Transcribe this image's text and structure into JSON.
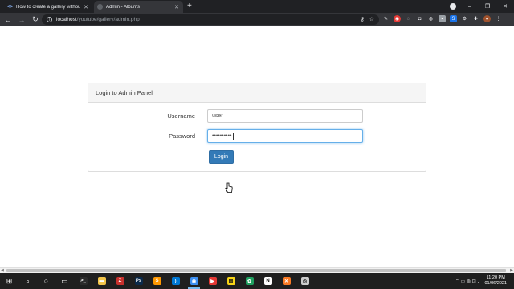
{
  "browser": {
    "tabs": [
      {
        "title": "How to create a gallery without a...",
        "icon": "code-icon",
        "active": false
      },
      {
        "title": "Admin - Albums",
        "icon": "globe-icon",
        "active": true
      }
    ],
    "new_tab_glyph": "+",
    "window_controls": {
      "minimize": "–",
      "maximize": "❐",
      "close": "✕"
    },
    "toolbar": {
      "back": "←",
      "forward": "→",
      "reload": "↻",
      "url_host": "localhost",
      "url_path": "/youtube/gallery/admin.php"
    }
  },
  "panel": {
    "heading": "Login to Admin Panel",
    "username_label": "Username",
    "username_value": "user",
    "password_label": "Password",
    "password_value": "••••••••••",
    "login_button": "Login"
  },
  "taskbar": {
    "time": "11:20 PM",
    "date": "01/06/2021",
    "items": [
      {
        "name": "windows-start-icon",
        "glyph": "⊞",
        "color": "#ffffff"
      },
      {
        "name": "search-icon",
        "glyph": "⌕",
        "color": "#ffffff"
      },
      {
        "name": "cortana-icon",
        "glyph": "○",
        "color": "#ffffff"
      },
      {
        "name": "task-view-icon",
        "glyph": "▭",
        "color": "#ffffff"
      },
      {
        "name": "terminal-icon",
        "glyph": ">_",
        "color": "#2b2b2b"
      },
      {
        "name": "file-explorer-icon",
        "glyph": "▬",
        "color": "#f3c54a"
      },
      {
        "name": "filezilla-icon",
        "glyph": "Z",
        "color": "#c8312d"
      },
      {
        "name": "photoshop-icon",
        "glyph": "Ps",
        "color": "#0b2a4a"
      },
      {
        "name": "sublime-text-icon",
        "glyph": "S",
        "color": "#ff9800"
      },
      {
        "name": "vscode-icon",
        "glyph": "⟩",
        "color": "#0078d4"
      },
      {
        "name": "chrome-icon",
        "glyph": "◉",
        "color": "#3c8ef0"
      },
      {
        "name": "youtube-icon",
        "glyph": "▶",
        "color": "#e53935"
      },
      {
        "name": "sticky-notes-icon",
        "glyph": "▤",
        "color": "#f7d417"
      },
      {
        "name": "app-green-icon",
        "glyph": "✿",
        "color": "#20a060"
      },
      {
        "name": "notion-icon",
        "glyph": "N",
        "color": "#ffffff"
      },
      {
        "name": "xampp-icon",
        "glyph": "✕",
        "color": "#fb7a24"
      },
      {
        "name": "obs-icon",
        "glyph": "◎",
        "color": "#cccccc"
      }
    ]
  },
  "colors": {
    "primary": "#337ab7",
    "focus": "#66afe9",
    "chrome_dark": "#202124"
  }
}
